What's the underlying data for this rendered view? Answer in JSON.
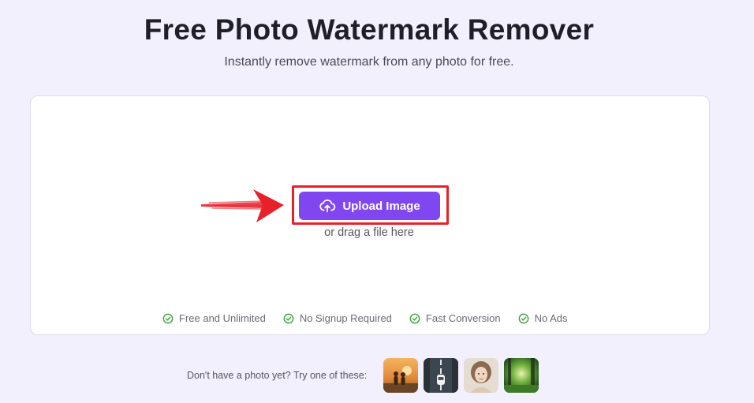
{
  "header": {
    "title": "Free Photo Watermark Remover",
    "subtitle": "Instantly remove watermark from any photo for free."
  },
  "upload": {
    "button_label": "Upload Image",
    "button_icon": "cloud-upload-icon",
    "drag_text": "or drag a file here"
  },
  "features": [
    {
      "label": "Free and Unlimited",
      "icon": "check-circle-icon"
    },
    {
      "label": "No Signup Required",
      "icon": "check-circle-icon"
    },
    {
      "label": "Fast Conversion",
      "icon": "check-circle-icon"
    },
    {
      "label": "No Ads",
      "icon": "check-circle-icon"
    }
  ],
  "samples": {
    "prompt": "Don't have a photo yet? Try one of these:",
    "thumbnails": [
      "sunset-couple",
      "road-car",
      "woman-portrait",
      "forest-light"
    ]
  },
  "colors": {
    "accent": "#8047f0",
    "highlight": "#e8202a",
    "check": "#3aa33a",
    "background": "#f3f0fd"
  }
}
